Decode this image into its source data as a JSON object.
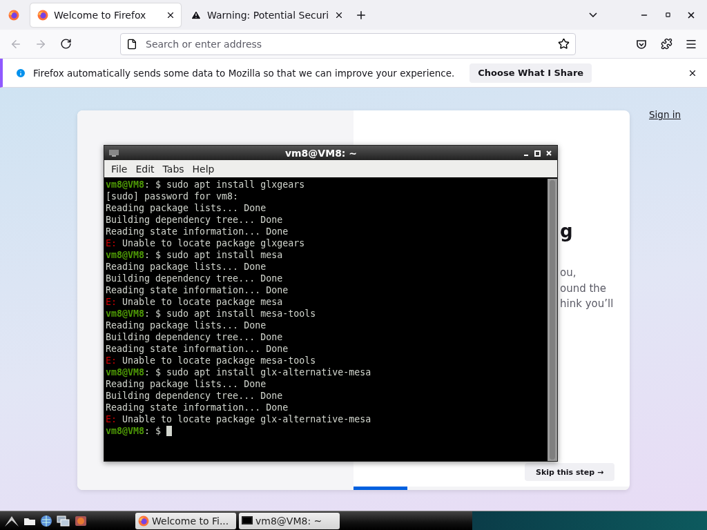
{
  "browser": {
    "tabs": [
      {
        "title": "Welcome to Firefox",
        "kind": "firefox",
        "selected": true
      },
      {
        "title": "Warning: Potential Securi",
        "kind": "warning",
        "selected": false
      }
    ],
    "nav": [
      {
        "kind": "back",
        "disabled": true
      },
      {
        "kind": "forward",
        "disabled": true
      },
      {
        "kind": "reload",
        "disabled": false
      }
    ],
    "address": {
      "placeholder": "Search or enter address"
    }
  },
  "notification": {
    "text": "Firefox automatically sends some data to Mozilla so that we can improve your experience.",
    "button": "Choose What I Share"
  },
  "page": {
    "sign_in": "Sign in",
    "heading_fragment": "g",
    "body_fragments": [
      "ou,",
      "ound the",
      "hink you’ll"
    ],
    "skip_button": "Skip this step →",
    "progress": {
      "level": 0.195
    }
  },
  "terminal": {
    "title": "vm8@VM8: ~",
    "menu": [
      "File",
      "Edit",
      "Tabs",
      "Help"
    ],
    "lines": [
      {
        "kind": "prompt",
        "user": "vm8@VM8",
        "sign": ": $",
        "text": "sudo apt install glxgears"
      },
      {
        "kind": "output",
        "text": "[sudo] password for vm8:"
      },
      {
        "kind": "output",
        "text": "Reading package lists... Done"
      },
      {
        "kind": "output",
        "text": "Building dependency tree... Done"
      },
      {
        "kind": "output",
        "text": "Reading state information... Done"
      },
      {
        "kind": "error",
        "label": "E:",
        "text": "Unable to locate package glxgears"
      },
      {
        "kind": "prompt",
        "user": "vm8@VM8",
        "sign": ": $",
        "text": "sudo apt install mesa"
      },
      {
        "kind": "output",
        "text": "Reading package lists... Done"
      },
      {
        "kind": "output",
        "text": "Building dependency tree... Done"
      },
      {
        "kind": "output",
        "text": "Reading state information... Done"
      },
      {
        "kind": "error",
        "label": "E:",
        "text": "Unable to locate package mesa"
      },
      {
        "kind": "prompt",
        "user": "vm8@VM8",
        "sign": ": $",
        "text": "sudo apt install mesa-tools"
      },
      {
        "kind": "output",
        "text": "Reading package lists... Done"
      },
      {
        "kind": "output",
        "text": "Building dependency tree... Done"
      },
      {
        "kind": "output",
        "text": "Reading state information... Done"
      },
      {
        "kind": "error",
        "label": "E:",
        "text": "Unable to locate package mesa-tools"
      },
      {
        "kind": "prompt",
        "user": "vm8@VM8",
        "sign": ": $",
        "text": "sudo apt install glx-alternative-mesa"
      },
      {
        "kind": "output",
        "text": "Reading package lists... Done"
      },
      {
        "kind": "output",
        "text": "Building dependency tree... Done"
      },
      {
        "kind": "output",
        "text": "Reading state information... Done"
      },
      {
        "kind": "error",
        "label": "E:",
        "text": "Unable to locate package glx-alternative-mesa"
      },
      {
        "kind": "prompt",
        "user": "vm8@VM8",
        "sign": ": $",
        "cursor": true
      }
    ]
  },
  "taskbar": {
    "tasks": [
      {
        "title": "Welcome to Fi...",
        "kind": "firefox"
      },
      {
        "title": "vm8@VM8: ~",
        "kind": "terminal"
      }
    ]
  }
}
